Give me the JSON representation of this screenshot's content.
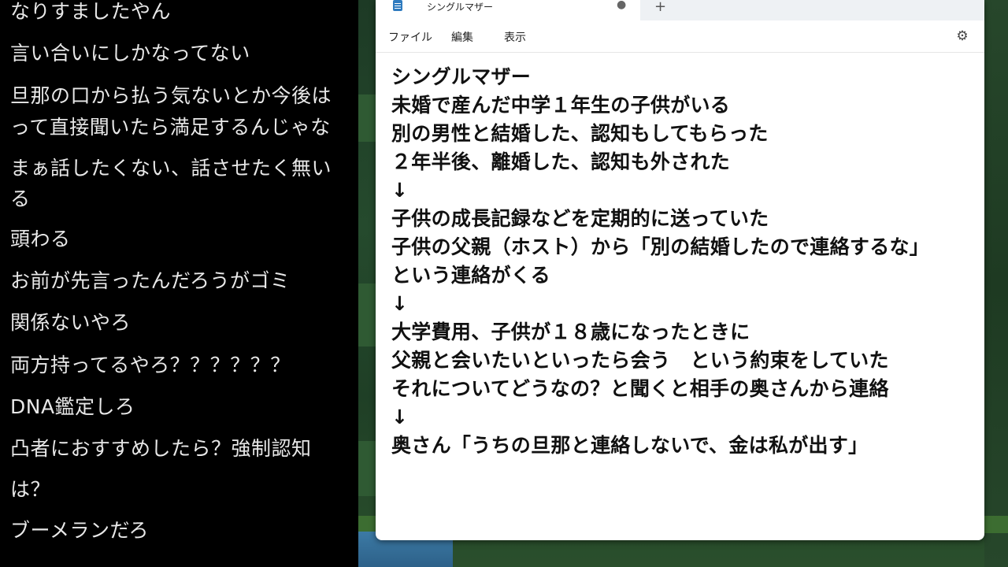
{
  "comments": [
    "なりすましたやん",
    "言い合いにしかなってない",
    "旦那の口から払う気ないとか今後は",
    "って直接聞いたら満足するんじゃな",
    "まぁ話したくない、話させたく無い",
    "る",
    "頭わる",
    "お前が先言ったんだろうがゴミ",
    "関係ないやろ",
    "両方持ってるやろ？？？？？？",
    "DNA鑑定しろ",
    "凸者におすすめしたら？強制認知",
    "は？",
    "ブーメランだろ"
  ],
  "notepad": {
    "tab_title": "シングルマザー",
    "unsaved_indicator": "●",
    "new_tab": "+",
    "menu": {
      "file": "ファイル",
      "edit": "編集",
      "view": "表示"
    },
    "settings_icon": "gear-icon",
    "lines": [
      "シングルマザー",
      "未婚で産んだ中学１年生の子供がいる",
      "別の男性と結婚した、認知もしてもらった",
      "２年半後、離婚した、認知も外された",
      "↓",
      "子供の成長記録などを定期的に送っていた",
      "子供の父親（ホスト）から「別の結婚したので連絡するな」",
      "という連絡がくる",
      "↓",
      "大学費用、子供が１８歳になったときに",
      "父親と会いたいといったら会う　という約束をしていた",
      "それについてどうなの？と聞くと相手の奥さんから連絡",
      "↓",
      "奥さん「うちの旦那と連絡しないで、金は私が出す」"
    ]
  },
  "colors": {
    "comment_text": "#e8e8e8",
    "comment_bg": "#000000",
    "editor_text": "#111111",
    "window_bg": "#ffffff",
    "tab_icon": "#2f7bbf"
  }
}
